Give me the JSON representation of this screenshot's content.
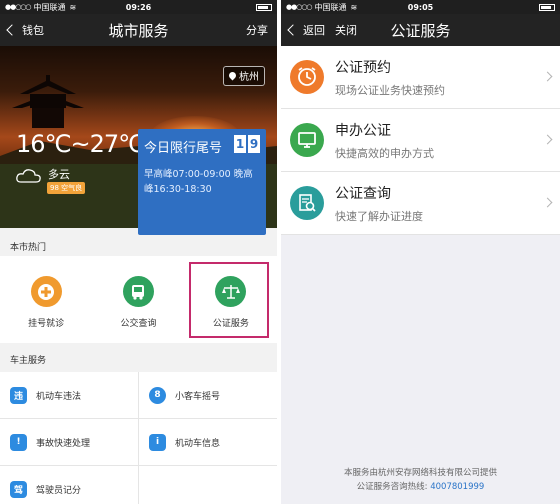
{
  "left": {
    "status": {
      "carrier": "中国联通",
      "time": "09:26"
    },
    "nav": {
      "back_label": "钱包",
      "title": "城市服务",
      "share_label": "分享"
    },
    "hero": {
      "city": "杭州",
      "temp_range": "16℃~27℃",
      "condition": "多云",
      "aqi_badge": "98 空气良",
      "limit_title": "今日限行尾号",
      "limit_digits": [
        "1",
        "9"
      ],
      "limit_hours": "早高峰07:00-09:00 晚高峰16:30-18:30"
    },
    "hot": {
      "section_label": "本市热门",
      "items": [
        {
          "label": "挂号就诊",
          "color": "#f09a2e",
          "icon": "hospital-cross-icon"
        },
        {
          "label": "公交查询",
          "color": "#2fa25e",
          "icon": "bus-icon"
        },
        {
          "label": "公证服务",
          "color": "#2fa25e",
          "icon": "scales-icon"
        }
      ]
    },
    "car": {
      "section_label": "车主服务",
      "items": [
        {
          "label": "机动车违法",
          "glyph": "违"
        },
        {
          "label": "小客车摇号",
          "glyph": "8"
        },
        {
          "label": "事故快速处理",
          "glyph": "!"
        },
        {
          "label": "机动车信息",
          "glyph": "i"
        },
        {
          "label": "驾驶员记分",
          "glyph": "驾"
        },
        {
          "label": "",
          "glyph": ""
        }
      ]
    }
  },
  "right": {
    "status": {
      "carrier": "中国联通",
      "time": "09:05"
    },
    "nav": {
      "back_label": "返回",
      "close_label": "关闭",
      "title": "公证服务"
    },
    "items": [
      {
        "title": "公证预约",
        "desc": "现场公证业务快速预约",
        "color": "#ef7a2b",
        "icon": "clock-icon"
      },
      {
        "title": "申办公证",
        "desc": "快捷高效的申办方式",
        "color": "#3aa84e",
        "icon": "monitor-icon"
      },
      {
        "title": "公证查询",
        "desc": "快速了解办证进度",
        "color": "#2a9d9b",
        "icon": "document-search-icon"
      }
    ],
    "footer": {
      "provider": "本服务由杭州安存网络科技有限公司提供",
      "hotline_label": "公证服务咨询热线:",
      "hotline_number": "4007801999"
    }
  }
}
